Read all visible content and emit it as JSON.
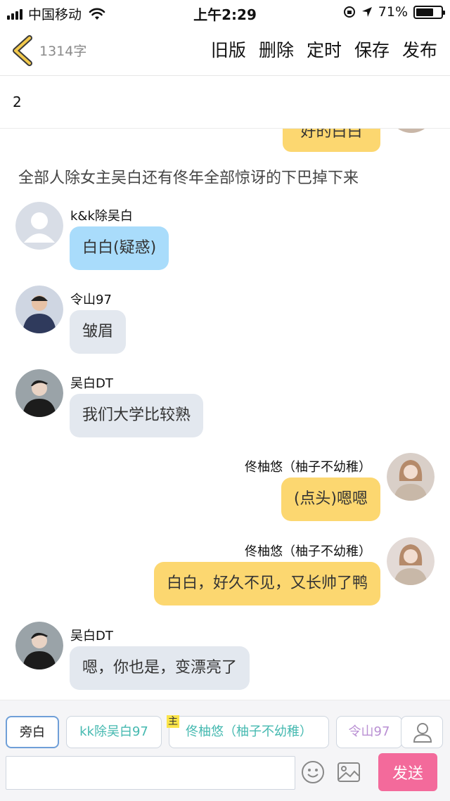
{
  "status_bar": {
    "carrier": "中国移动",
    "time": "上午2:29",
    "battery": "71%",
    "battery_level": 0.71
  },
  "header": {
    "word_count": "1314字",
    "actions": [
      "旧版",
      "删除",
      "定时",
      "保存",
      "发布"
    ]
  },
  "document": {
    "title": "2"
  },
  "chat": {
    "partial_message": "好的白白",
    "narration": "全部人除女主吴白还有佟年全部惊讶的下巴掉下来",
    "messages": [
      {
        "side": "left",
        "name": "k&k除吴白",
        "text": "白白(疑惑)",
        "avatar": "default-avatar"
      },
      {
        "side": "left",
        "name": "令山97",
        "text": "皱眉",
        "avatar": "photo-avatar"
      },
      {
        "side": "left",
        "name": "吴白DT",
        "text": "我们大学比较熟",
        "avatar": "photo-avatar"
      },
      {
        "side": "right",
        "name": "佟柚悠（柚子不幼稚）",
        "text": "(点头)嗯嗯",
        "avatar": "photo-avatar"
      },
      {
        "side": "right",
        "name": "佟柚悠（柚子不幼稚）",
        "text": "白白，好久不见，又长帅了鸭",
        "avatar": "photo-avatar"
      },
      {
        "side": "left",
        "name": "吴白DT",
        "text": "嗯，你也是，变漂亮了",
        "avatar": "photo-avatar"
      }
    ]
  },
  "bottom": {
    "roles": {
      "narrator": "旁白",
      "kk": "kk除吴白97",
      "main_tag": "主",
      "tong": "佟柚悠（柚子不幼稚）",
      "lingshan": "令山97"
    },
    "input_placeholder": "",
    "send": "发送"
  },
  "colors": {
    "bubble_blue": "#a9dcfb",
    "bubble_gray": "#e3e8ef",
    "bubble_yellow": "#fcd770",
    "send_pink": "#f36a9b",
    "back_yellow": "#f2c94c"
  }
}
